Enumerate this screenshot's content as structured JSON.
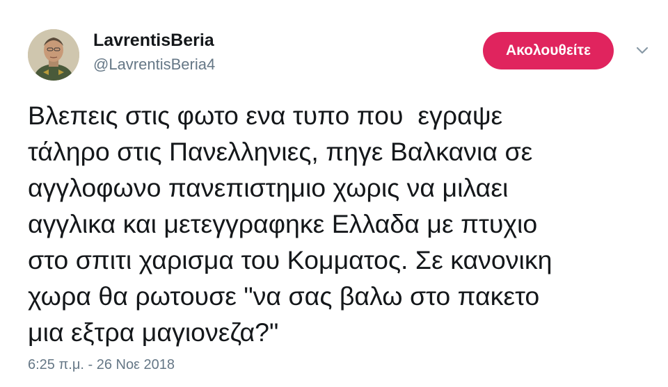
{
  "user": {
    "display_name": "LavrentisBeria",
    "handle": "@LavrentisBeria4",
    "avatar_icon": "profile-photo"
  },
  "actions": {
    "follow_label": "Ακολουθείτε",
    "follow_color": "#e0245e",
    "more_icon": "chevron-down-icon"
  },
  "tweet": {
    "lines": [
      "Βλεπεις στις φωτο ενα τυπο που  εγραψε",
      "τάληρο στις Πανελληνιες, πηγε Βαλκανια σε",
      "αγγλοφωνο πανεπιστημιο χωρις να μιλαει",
      "αγγλικα και μετεγγραφηκε Ελλαδα με πτυχιο",
      "στο σπιτι χαρισμα του Κομματος. Σε κανονικη",
      "χωρα θα ρωτουσε \"να σας βαλω στο πακετο",
      "μια εξτρα μαγιονεζα?\""
    ],
    "timestamp": "6:25 π.μ. - 26 Νοε 2018"
  }
}
